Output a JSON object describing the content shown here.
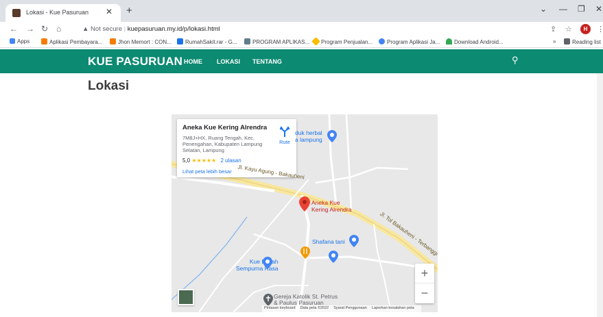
{
  "browser": {
    "tab_title": "Lokasi - Kue Pasuruan",
    "url_prefix": "Not secure",
    "url": "kuepasuruan.my.id/p/lokasi.html",
    "profile_initial": "H",
    "bookmarks": [
      {
        "label": "Apps",
        "color": "#4285f4"
      },
      {
        "label": "Aplikasi Pembayara...",
        "color": "#f57c00"
      },
      {
        "label": "Jhon Memort : CON...",
        "color": "#f57c00"
      },
      {
        "label": "RumahSakit.rar - G...",
        "color": "#1a73e8"
      },
      {
        "label": "PROGRAM APLIKAS...",
        "color": "#607d8b"
      },
      {
        "label": "Program Penjualan...",
        "color": "#fbbc04"
      },
      {
        "label": "Program Aplikasi Ja...",
        "color": "#4285f4"
      },
      {
        "label": "Download Android...",
        "color": "#34a853"
      }
    ],
    "reading_list": "Reading list"
  },
  "site": {
    "brand": "KUE PASURUAN",
    "nav": [
      "HOME",
      "LOKASI",
      "TENTANG"
    ],
    "page_title": "Lokasi",
    "header_color": "#0c8a72"
  },
  "map": {
    "place_name": "Aneka Kue Kering Alrendra",
    "address": "7M8J+HX, Ruang Tengah, Kec. Penengahan, Kabupaten Lampung Selatan, Lampung",
    "rating": "5,0",
    "stars": "★★★★★",
    "reviews": "2 ulasan",
    "larger_map": "Lihat peta lebih besar",
    "directions": "Rute",
    "labels": {
      "marker": [
        "Aneka Kue",
        "Kering Alrendra"
      ],
      "road1": "Jl. Kayu Agung - Bakauheni",
      "road2": "Jl. Tol Bakauheni - Terbanggi",
      "herbal": [
        "duk herbal",
        "a lampung"
      ],
      "shafana": "Shafana tani",
      "kuebasah": [
        "Kue Basah",
        "Sempurna Rasa"
      ],
      "gereja": [
        "Gereja Katolik St. Petrus",
        "& Paulus Pasuruan"
      ]
    },
    "zoom_in": "+",
    "zoom_out": "−",
    "attribution": [
      "Pintasan keyboard",
      "Data peta ©2022",
      "Syarat Penggunaan",
      "Laporkan kesalahan peta"
    ]
  }
}
